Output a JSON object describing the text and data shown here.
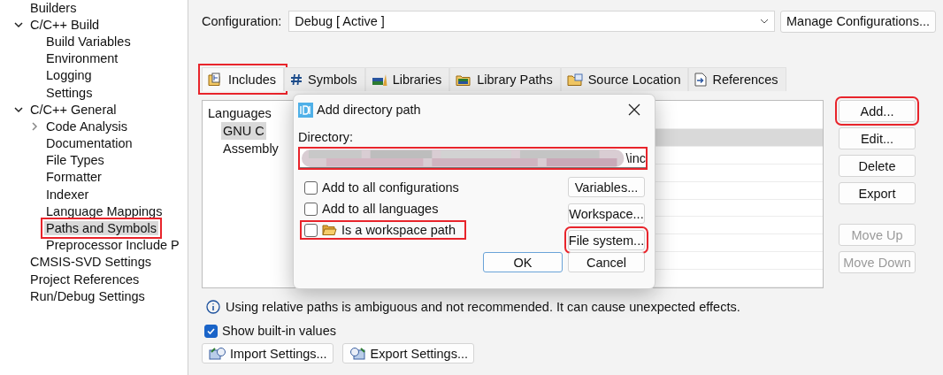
{
  "tree": [
    {
      "label": "Builders",
      "selected": false,
      "highlighted": false
    },
    {
      "label": "C/C++ Build",
      "selected": false,
      "highlighted": false,
      "expanded": true,
      "children": [
        {
          "label": "Build Variables",
          "selected": false,
          "highlighted": false
        },
        {
          "label": "Environment",
          "selected": false,
          "highlighted": false
        },
        {
          "label": "Logging",
          "selected": false,
          "highlighted": false
        },
        {
          "label": "Settings",
          "selected": false,
          "highlighted": false
        }
      ]
    },
    {
      "label": "C/C++ General",
      "selected": false,
      "highlighted": false,
      "expanded": true,
      "children": [
        {
          "label": "Code Analysis",
          "selected": false,
          "highlighted": false,
          "expanded": false
        },
        {
          "label": "Documentation",
          "selected": false,
          "highlighted": false
        },
        {
          "label": "File Types",
          "selected": false,
          "highlighted": false
        },
        {
          "label": "Formatter",
          "selected": false,
          "highlighted": false
        },
        {
          "label": "Indexer",
          "selected": false,
          "highlighted": false
        },
        {
          "label": "Language Mappings",
          "selected": false,
          "highlighted": false
        },
        {
          "label": "Paths and Symbols",
          "selected": true,
          "highlighted": true
        },
        {
          "label": "Preprocessor Include P",
          "selected": false,
          "highlighted": false
        }
      ]
    },
    {
      "label": "CMSIS-SVD Settings",
      "selected": false,
      "highlighted": false
    },
    {
      "label": "Project References",
      "selected": false,
      "highlighted": false
    },
    {
      "label": "Run/Debug Settings",
      "selected": false,
      "highlighted": false
    }
  ],
  "configuration": {
    "label": "Configuration:",
    "value": "Debug  [ Active ]",
    "button": "Manage Configurations..."
  },
  "tabs": [
    {
      "label": "Includes",
      "kind": "includes",
      "selected": true,
      "highlighted": true
    },
    {
      "label": "Symbols",
      "kind": "symbols",
      "selected": false,
      "highlighted": false
    },
    {
      "label": "Libraries",
      "kind": "libraries",
      "selected": false,
      "highlighted": false
    },
    {
      "label": "Library Paths",
      "kind": "librarypaths",
      "selected": false,
      "highlighted": false
    },
    {
      "label": "Source Location",
      "kind": "source",
      "selected": false,
      "highlighted": false
    },
    {
      "label": "References",
      "kind": "references",
      "selected": false,
      "highlighted": false
    }
  ],
  "languages": {
    "heading": "Languages",
    "items": [
      {
        "label": "GNU C",
        "selected": true
      },
      {
        "label": "Assembly",
        "selected": false
      }
    ]
  },
  "entry_rows": [
    {
      "selected": false
    },
    {
      "selected": true
    },
    {
      "selected": false
    },
    {
      "selected": false
    },
    {
      "selected": false
    },
    {
      "selected": false
    },
    {
      "selected": false
    },
    {
      "selected": false
    },
    {
      "selected": false
    },
    {
      "selected": false
    }
  ],
  "side_buttons": [
    {
      "label": "Add...",
      "disabled": false,
      "highlighted": true,
      "gap": false
    },
    {
      "label": "Edit...",
      "disabled": false,
      "highlighted": false,
      "gap": false
    },
    {
      "label": "Delete",
      "disabled": false,
      "highlighted": false,
      "gap": false
    },
    {
      "label": "Export",
      "disabled": false,
      "highlighted": false,
      "gap": false
    },
    {
      "label": "Move Up",
      "disabled": true,
      "highlighted": false,
      "gap": true
    },
    {
      "label": "Move Down",
      "disabled": true,
      "highlighted": false,
      "gap": false
    }
  ],
  "info": "Using relative paths is ambiguous and not recommended. It can cause unexpected effects.",
  "show_builtin": {
    "label": "Show built-in values",
    "checked": true
  },
  "bottom_buttons": [
    {
      "label": "Import Settings...",
      "kind": "import"
    },
    {
      "label": "Export Settings...",
      "kind": "export"
    }
  ],
  "dialog": {
    "title": "Add directory path",
    "directory": {
      "label": "Directory:",
      "value": "\\inc",
      "highlighted": true
    },
    "options": [
      {
        "label": "Add to all configurations",
        "checked": false,
        "highlighted": false,
        "kind": "plain"
      },
      {
        "label": "Add to all languages",
        "checked": false,
        "highlighted": false,
        "kind": "plain"
      },
      {
        "label": "Is a workspace path",
        "checked": false,
        "highlighted": true,
        "kind": "folder"
      }
    ],
    "side_buttons": [
      {
        "label": "Variables...",
        "highlighted": false
      },
      {
        "label": "Workspace...",
        "highlighted": false
      },
      {
        "label": "File system...",
        "highlighted": true
      }
    ],
    "buttons": [
      {
        "label": "OK",
        "default": true
      },
      {
        "label": "Cancel",
        "default": false
      }
    ]
  }
}
